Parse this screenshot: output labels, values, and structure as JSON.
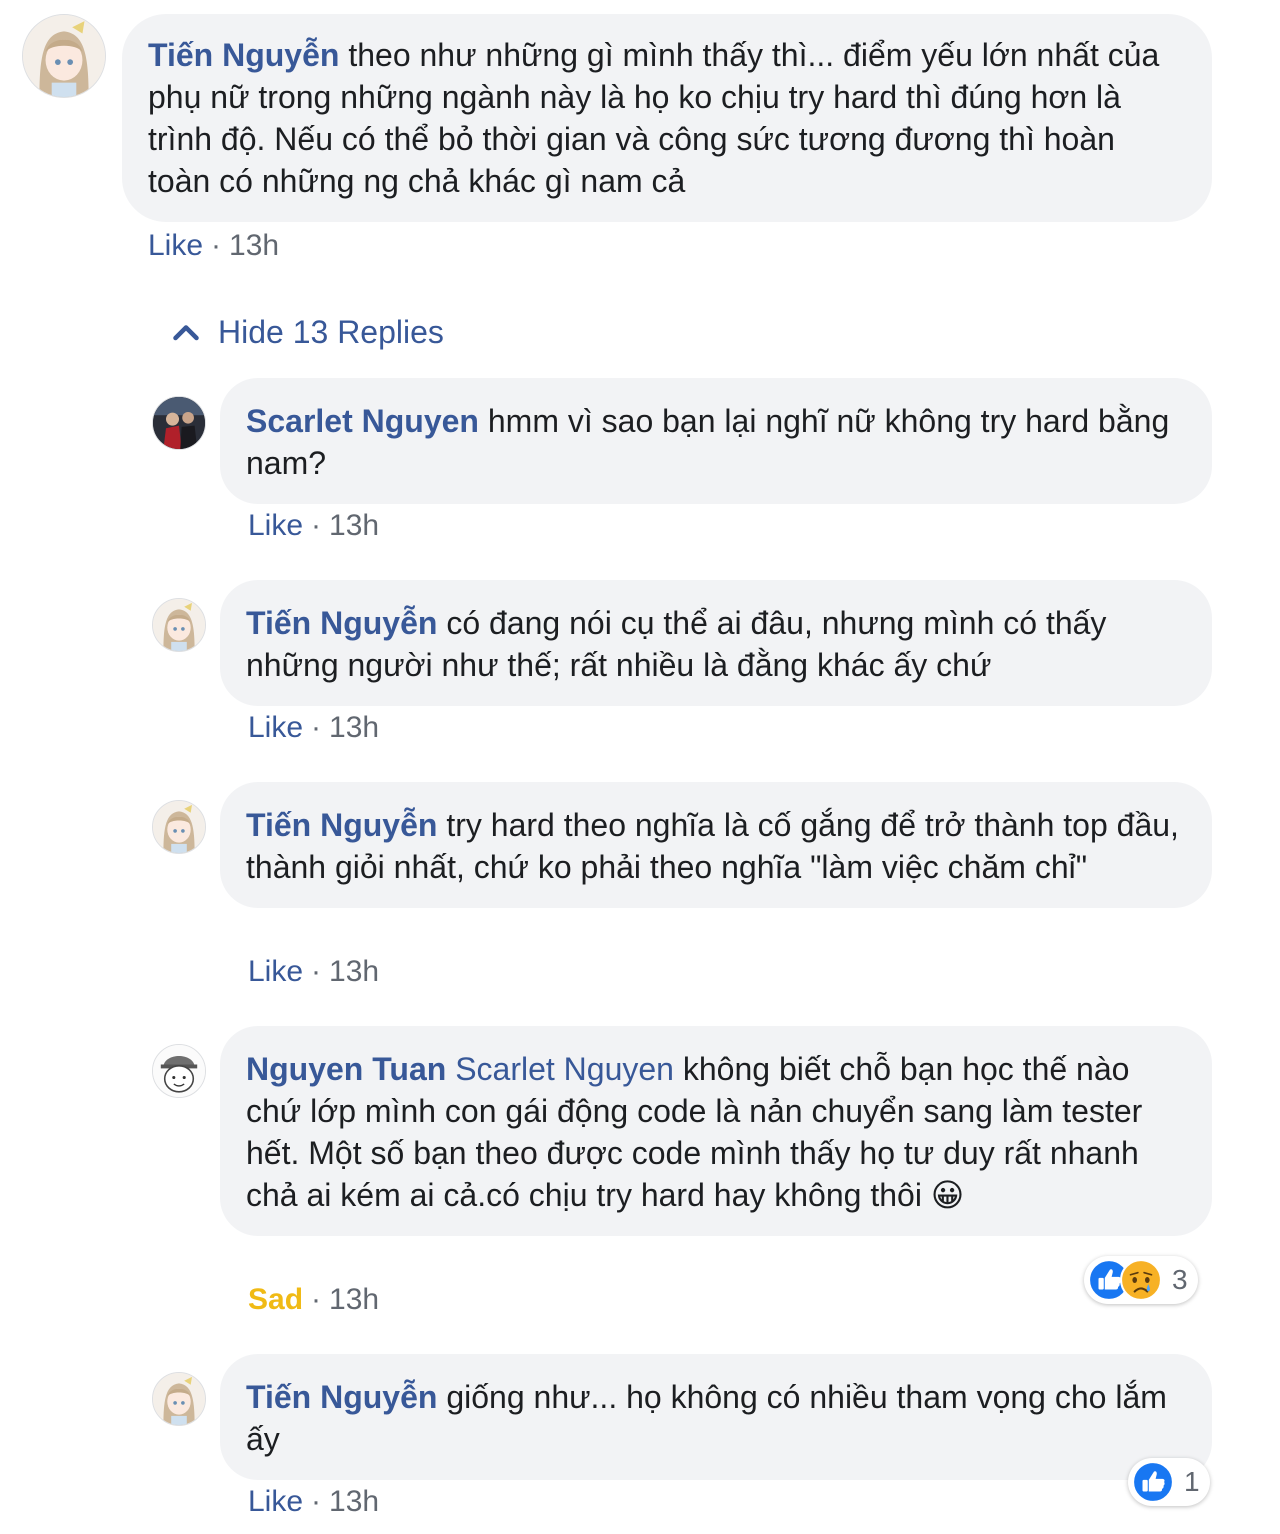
{
  "comment": {
    "author": "Tiến Nguyễn",
    "text": " theo như những gì mình thấy thì... điểm yếu lớn nhất của phụ nữ trong những ngành này là họ ko chịu try hard thì đúng hơn là trình độ. Nếu có thể bỏ thời gian và công sức tương đương thì hoàn toàn có những ng chả khác gì nam cả",
    "action": "Like",
    "separator": "·",
    "time": "13h"
  },
  "replies_toggle": {
    "label": "Hide 13 Replies",
    "icon": "chevron-up-icon"
  },
  "replies": [
    {
      "author": "Scarlet Nguyen",
      "mention": "",
      "text": " hmm vì sao bạn lại nghĩ nữ không try hard bằng nam?",
      "action": "Like",
      "separator": "·",
      "time": "13h"
    },
    {
      "author": "Tiến Nguyễn",
      "mention": "",
      "text": " có đang nói cụ thể ai đâu, nhưng mình có thấy những người như thế; rất nhiều là đằng khác ấy chứ",
      "action": "Like",
      "separator": "·",
      "time": "13h"
    },
    {
      "author": "Tiến Nguyễn",
      "mention": "",
      "text": " try hard theo nghĩa là cố gắng để trở thành top đầu, thành giỏi nhất, chứ ko phải theo nghĩa \"làm việc chăm chỉ\"",
      "action": "Like",
      "separator": "·",
      "time": "13h"
    },
    {
      "author": "Nguyen Tuan",
      "mention": " Scarlet Nguyen",
      "text": " không biết chỗ bạn học thế nào chứ lớp mình con gái động code là nản chuyển sang làm tester hết. Một số bạn theo được code mình thấy họ tư duy rất nhanh chả ai kém ai cả.có chịu try hard hay không thôi ",
      "emoji": "😀",
      "action": "Sad",
      "separator": "·",
      "time": "13h",
      "reactions": {
        "icons": [
          "like-reaction-icon",
          "sad-reaction-icon"
        ],
        "count": "3"
      }
    },
    {
      "author": "Tiến Nguyễn",
      "mention": "",
      "text": " giống như... họ không có nhiều tham vọng cho lắm ấy",
      "action": "Like",
      "separator": "·",
      "time": "13h",
      "reactions": {
        "icons": [
          "like-reaction-icon"
        ],
        "count": "1"
      }
    }
  ]
}
